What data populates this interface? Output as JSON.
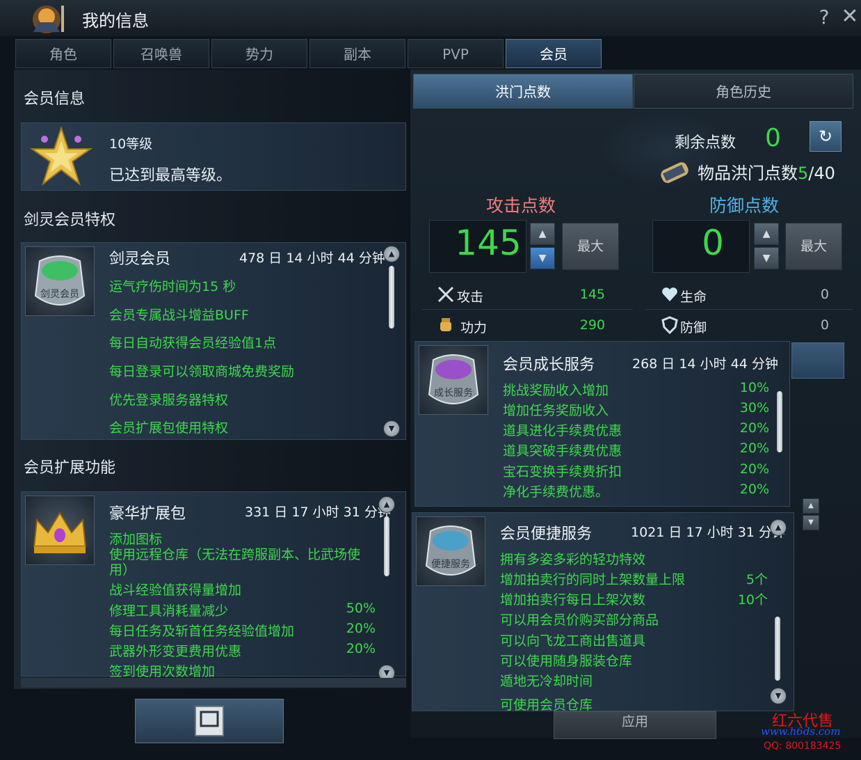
{
  "window": {
    "title": "我的信息",
    "help": "?",
    "close": "✕"
  },
  "tabs": [
    "角色",
    "召唤兽",
    "势力",
    "副本",
    "PVP",
    "会员"
  ],
  "left": {
    "member_info_title": "会员信息",
    "level": "10等级",
    "level_desc": "已达到最高等级。",
    "privilege_title": "剑灵会员特权",
    "privilege_card": {
      "icon_text": "剑灵会员",
      "name": "剑灵会员",
      "time": "478 日 14 小时 44 分钟",
      "items": [
        "运气疗伤时间为15 秒",
        "会员专属战斗增益BUFF",
        "每日自动获得会员经验值1点",
        "每日登录可以领取商城免费奖励",
        "优先登录服务器特权",
        "会员扩展包使用特权"
      ]
    },
    "ext_title": "会员扩展功能",
    "ext_card": {
      "name": "豪华扩展包",
      "time": "331 日 17 小时 31 分钟",
      "items": [
        {
          "text": "添加图标",
          "value": ""
        },
        {
          "text": "使用远程仓库（无法在跨服副本、比武场使用）",
          "value": ""
        },
        {
          "text": "战斗经验值获得量增加",
          "value": ""
        },
        {
          "text": "修理工具消耗量减少",
          "value": "50%"
        },
        {
          "text": "每日任务及斩首任务经验值增加",
          "value": "20%"
        },
        {
          "text": "武器外形变更费用优惠",
          "value": "20%"
        },
        {
          "text": "签到使用次数增加",
          "value": ""
        }
      ]
    }
  },
  "right": {
    "subtabs": [
      "洪门点数",
      "角色历史"
    ],
    "remaining_label": "剩余点数",
    "remaining_value": "0",
    "item_points_label": "物品洪门点数",
    "item_points_current": "5",
    "item_points_total": "/40",
    "attack_title": "攻击点数",
    "defense_title": "防御点数",
    "attack_points": "145",
    "defense_points": "0",
    "max_label": "最大",
    "stats": [
      {
        "label": "攻击",
        "value": "145"
      },
      {
        "label": "功力",
        "value": "290"
      },
      {
        "label": "生命",
        "value": "0"
      },
      {
        "label": "防御",
        "value": "0"
      }
    ],
    "growth_card": {
      "icon_text": "成长服务",
      "name": "会员成长服务",
      "time": "268 日 14 小时 44 分钟",
      "items": [
        {
          "text": "挑战奖励收入增加",
          "value": "10%"
        },
        {
          "text": "增加任务奖励收入",
          "value": "30%"
        },
        {
          "text": "道具进化手续费优惠",
          "value": "20%"
        },
        {
          "text": "道具突破手续费优惠",
          "value": "20%"
        },
        {
          "text": "宝石变换手续费折扣",
          "value": "20%"
        },
        {
          "text": "净化手续费优惠。",
          "value": "20%"
        }
      ]
    },
    "convenience_card": {
      "icon_text": "便捷服务",
      "name": "会员便捷服务",
      "time": "1021 日 17 小时 31 分钟",
      "items": [
        {
          "text": "拥有多姿多彩的轻功特效",
          "value": ""
        },
        {
          "text": "增加拍卖行的同时上架数量上限",
          "value": "5个"
        },
        {
          "text": "增加拍卖行每日上架次数",
          "value": "10个"
        },
        {
          "text": "可以用会员价购买部分商品",
          "value": ""
        },
        {
          "text": "可以向飞龙工商出售道具",
          "value": ""
        },
        {
          "text": "可以使用随身服装仓库",
          "value": ""
        },
        {
          "text": "遁地无冷却时间",
          "value": ""
        },
        {
          "text": "可使用会员仓库",
          "value": ""
        }
      ]
    },
    "apply_label": "应用"
  },
  "watermark": {
    "line1": "红六代售",
    "line2": "www.h6ds.com",
    "line3": "QQ: 800183425"
  },
  "colors": {
    "green": "#3ed84b",
    "pink": "#f07d7d",
    "blue": "#4fb3e8"
  }
}
